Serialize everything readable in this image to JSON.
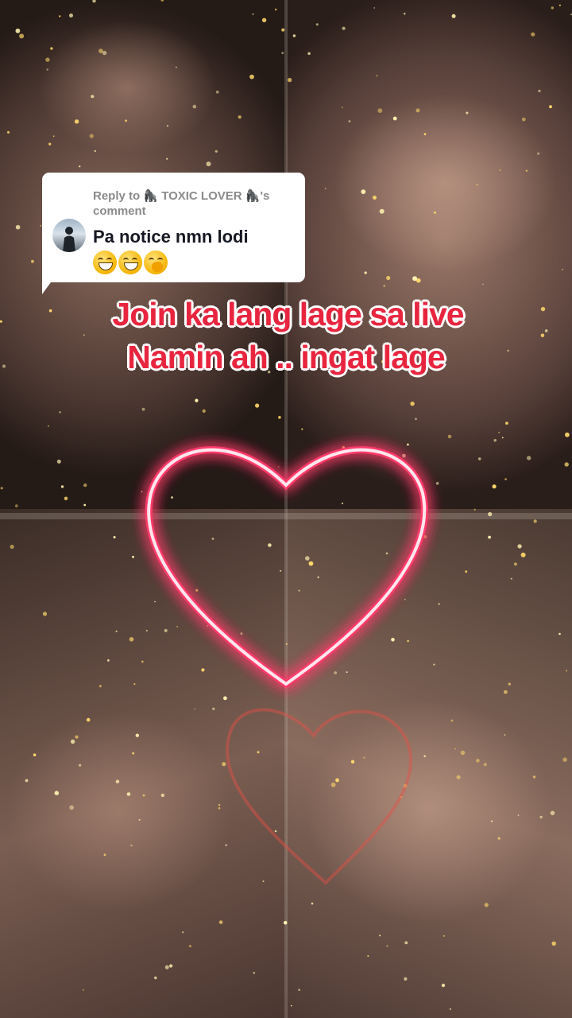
{
  "reply": {
    "prefix": "Reply to ",
    "username": "🦍 TOXIC LOVER 🦍",
    "suffix": "'s",
    "comment_word": "comment",
    "comment_text": "Pa notice nmn lodi",
    "emojis": [
      "beaming-face-emoji",
      "grinning-face-emoji",
      "hand-over-mouth-emoji"
    ]
  },
  "caption": {
    "line1": "Join ka lang lage sa live",
    "line2": "Namin ah .. ingat lage"
  },
  "colors": {
    "caption_text": "#e8253f",
    "caption_outline": "#ffffff",
    "neon_heart": "#ff3b6b",
    "bubble_bg": "#ffffff"
  }
}
